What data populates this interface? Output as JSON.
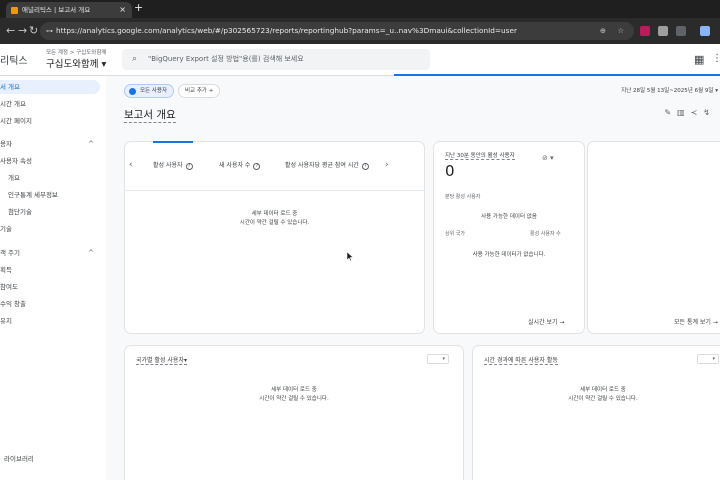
{
  "browser": {
    "tab_title": "애널리틱스 | 보고서 개요",
    "tab_close": "×",
    "new_tab": "+",
    "url": "https://analytics.google.com/analytics/web/#/p302565723/reports/reportinghub?params=_u..nav%3Dmaui&collectionId=user",
    "nav_icons": [
      "←",
      "→",
      "↻"
    ]
  },
  "header": {
    "product": "리틱스",
    "breadcrumb": "모든 계정 > 구십도와함께",
    "property": "구십도와함께",
    "search_placeholder": "\"BigQuery Export 설정 방법\"용(를) 검색해 보세요"
  },
  "sidebar": {
    "items": [
      {
        "label": "서 개요",
        "active": true
      },
      {
        "label": "시간 개요"
      },
      {
        "label": "시간 페이지"
      },
      {
        "label": "용자",
        "chevron": "^"
      },
      {
        "label": "사용자 속성"
      },
      {
        "label": "개요"
      },
      {
        "label": "인구통계 세부정보"
      },
      {
        "label": "첨단기술"
      },
      {
        "label": "기술"
      },
      {
        "label": "객 주기",
        "chevron": "^"
      },
      {
        "label": "획득"
      },
      {
        "label": "참여도"
      },
      {
        "label": "수익 창출"
      },
      {
        "label": "유지"
      },
      {
        "label": "라이브러리"
      }
    ]
  },
  "main": {
    "filter_all": "모든 사용자",
    "filter_add": "비교 추가 +",
    "date_range": "지난 28일 5월 13일~2025년 6월 9일",
    "title": "보고서 개요",
    "metrics": {
      "tabs": [
        "활성 사용자",
        "새 사용자 수",
        "활성 사용자당 평균 참여 시간"
      ],
      "help": "?",
      "loading_1": "세부 데이터 로드 중",
      "loading_2": "시간이 약간 걸릴 수 있습니다."
    },
    "realtime": {
      "title": "지난 30분 동안의 활성 사용자",
      "value": "0",
      "per_minute": "분당 활성 사용자",
      "empty_1": "사용 가능한 데이터 없음",
      "col_country": "상위 국가",
      "col_users": "활성 사용자 수",
      "empty_2": "사용 가능한 데이터가 없습니다.",
      "link": "실시간 보기 →"
    },
    "insights": {
      "link": "모든 통계 보기 →"
    },
    "country_card": {
      "title": "국가별 활성 사용자",
      "loading_1": "세부 데이터 로드 중",
      "loading_2": "시간이 약간 걸릴 수 있습니다."
    },
    "trend_card": {
      "title": "시간 경과에 따른 사용자 활동",
      "loading_1": "세부 데이터 로드 중",
      "loading_2": "시간이 약간 걸릴 수 있습니다."
    }
  },
  "colors": {
    "accent": "#1a73e8",
    "active_bg": "#e8f0fe"
  }
}
